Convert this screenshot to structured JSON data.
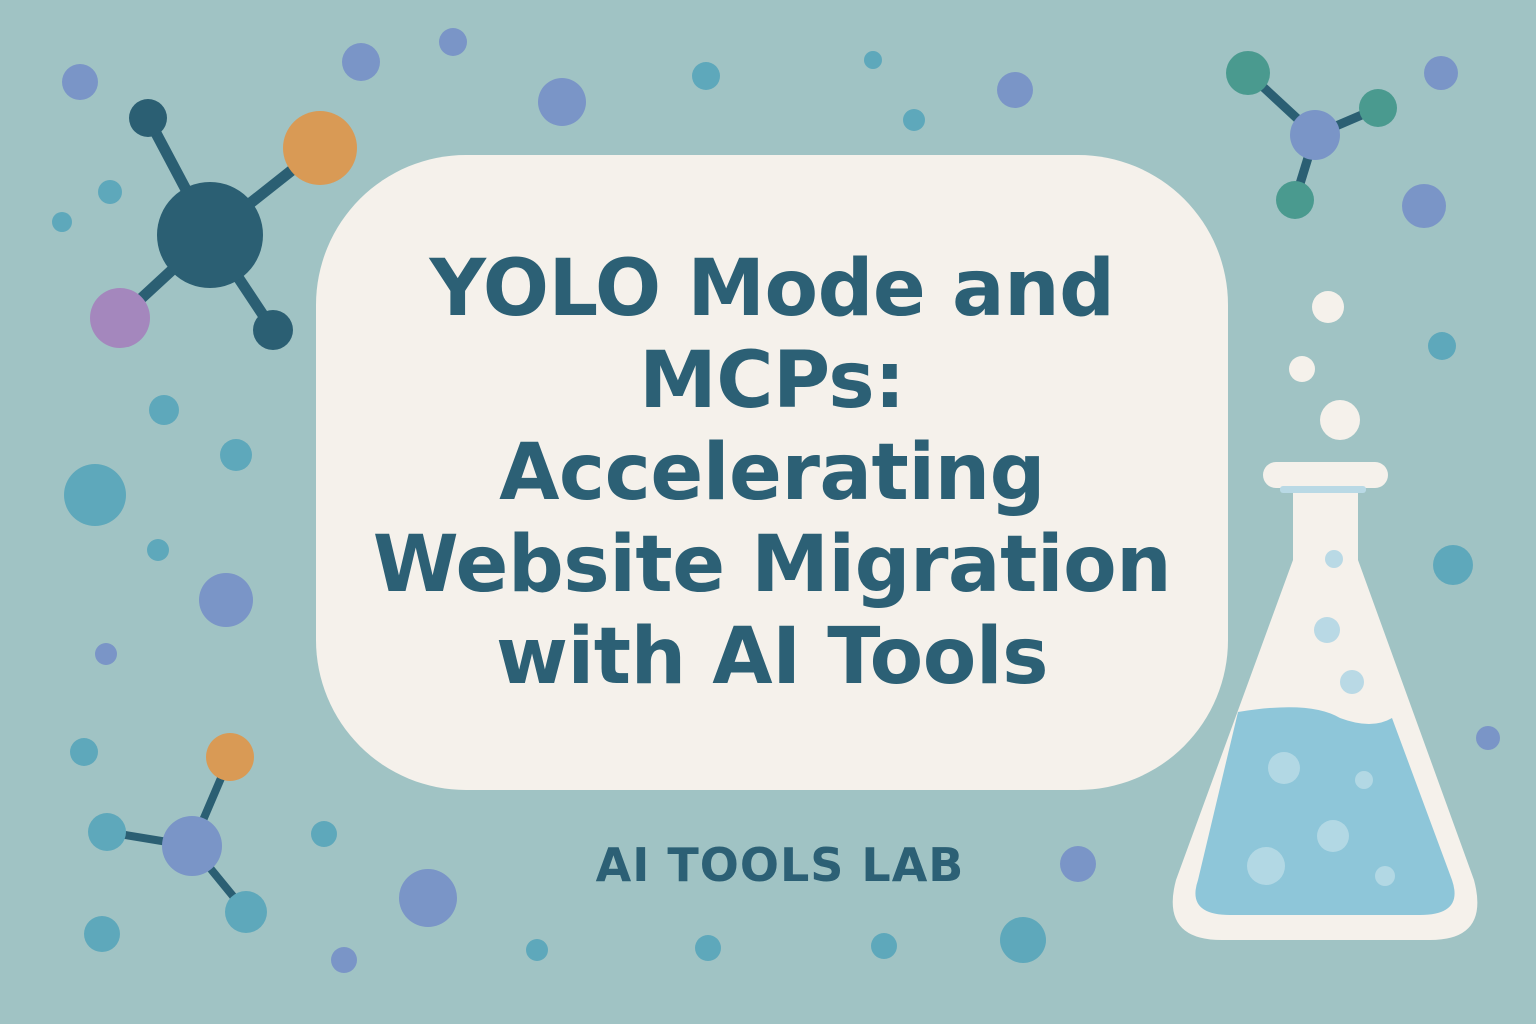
{
  "headline": {
    "lines": [
      "YOLO Mode and",
      "MCPs:",
      "Accelerating",
      "Website Migration",
      "with AI Tools"
    ]
  },
  "brand": {
    "label": "AI TOOLS LAB"
  },
  "colors": {
    "background": "#a0c3c4",
    "card": "#f5f1eb",
    "text": "#2c6075",
    "molecule_dark": "#2b5f73",
    "accent_orange": "#d99a55",
    "accent_purple": "#a487bd",
    "dot_blue": "#7a95c7",
    "dot_teal": "#5ea8bb",
    "molecule_green": "#4a9a8f",
    "liquid": "#8ec6d9"
  },
  "icons": [
    "molecule-icon",
    "flask-icon",
    "bubble-icon"
  ]
}
